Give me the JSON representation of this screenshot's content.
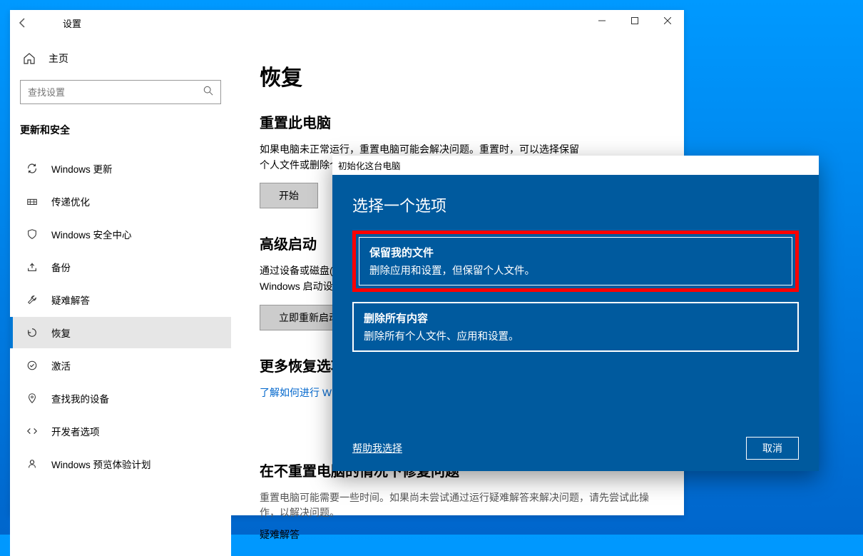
{
  "window": {
    "title": "设置",
    "back_label": "←"
  },
  "sidebar": {
    "home_label": "主页",
    "search_placeholder": "查找设置",
    "category_label": "更新和安全",
    "items": [
      {
        "icon": "sync-icon",
        "label": "Windows 更新"
      },
      {
        "icon": "delivery-icon",
        "label": "传递优化"
      },
      {
        "icon": "shield-icon",
        "label": "Windows 安全中心"
      },
      {
        "icon": "backup-icon",
        "label": "备份"
      },
      {
        "icon": "troubleshoot-icon",
        "label": "疑难解答"
      },
      {
        "icon": "recovery-icon",
        "label": "恢复"
      },
      {
        "icon": "activation-icon",
        "label": "激活"
      },
      {
        "icon": "find-device-icon",
        "label": "查找我的设备"
      },
      {
        "icon": "dev-icon",
        "label": "开发者选项"
      },
      {
        "icon": "insider-icon",
        "label": "Windows 预览体验计划"
      }
    ],
    "active_index": 5
  },
  "main": {
    "page_title": "恢复",
    "sections": {
      "reset": {
        "title": "重置此电脑",
        "desc": "如果电脑未正常运行，重置电脑可能会解决问题。重置时，可以选择保留个人文件或删除个人文件，然后重新安装 Windows。",
        "button": "开始"
      },
      "advanced": {
        "title": "高级启动",
        "desc": "通过设备或磁盘(如 U 盘或 DVD)启动，更改你的电脑固件设置，更改 Windows 启动设置，或者从系统映像还原 Windows。这将重新启动电脑。",
        "button": "立即重新启动"
      },
      "more": {
        "title": "更多恢复选项",
        "link": "了解如何进行 Windows 的全新安装以便开始全新的体验"
      },
      "help": {
        "title": "在不重置电脑的情况下修复问题",
        "desc": "重置电脑可能需要一些时间。如果尚未尝试通过运行疑难解答来解决问题，请先尝试此操作，以解决问题。",
        "link": "疑难解答"
      }
    }
  },
  "modal": {
    "title": "初始化这台电脑",
    "heading": "选择一个选项",
    "options": [
      {
        "title": "保留我的文件",
        "desc": "删除应用和设置，但保留个人文件。"
      },
      {
        "title": "删除所有内容",
        "desc": "删除所有个人文件、应用和设置。"
      }
    ],
    "help_link": "帮助我选择",
    "cancel": "取消"
  }
}
